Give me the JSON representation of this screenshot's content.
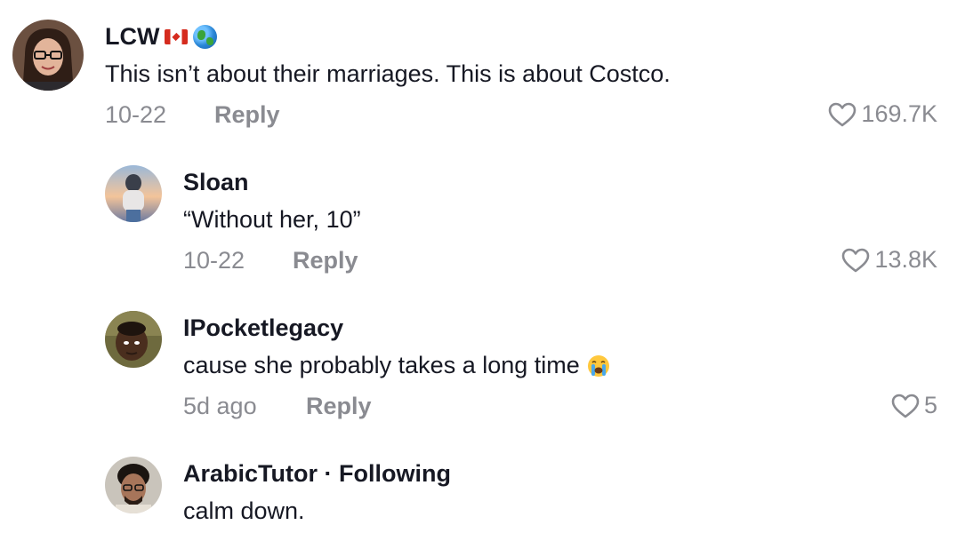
{
  "comments": [
    {
      "username": "LCW",
      "username_icons": [
        "canada-flag-icon",
        "globe-icon"
      ],
      "text": "This isn’t about their marriages. This is about Costco.",
      "date": "10-22",
      "reply_label": "Reply",
      "likes": "169.7K"
    },
    {
      "username": "Sloan",
      "text": "“Without her, 10”",
      "date": "10-22",
      "reply_label": "Reply",
      "likes": "13.8K"
    },
    {
      "username": "IPocketlegacy",
      "text": "cause she probably takes a long time",
      "text_icon": "loudly-crying-face-icon",
      "date": "5d ago",
      "reply_label": "Reply",
      "likes": "5"
    },
    {
      "username": "ArabicTutor · Following",
      "text": "calm down."
    }
  ],
  "colors": {
    "primary_text": "#161823",
    "secondary_text": "#8a8b91",
    "background": "#ffffff"
  }
}
